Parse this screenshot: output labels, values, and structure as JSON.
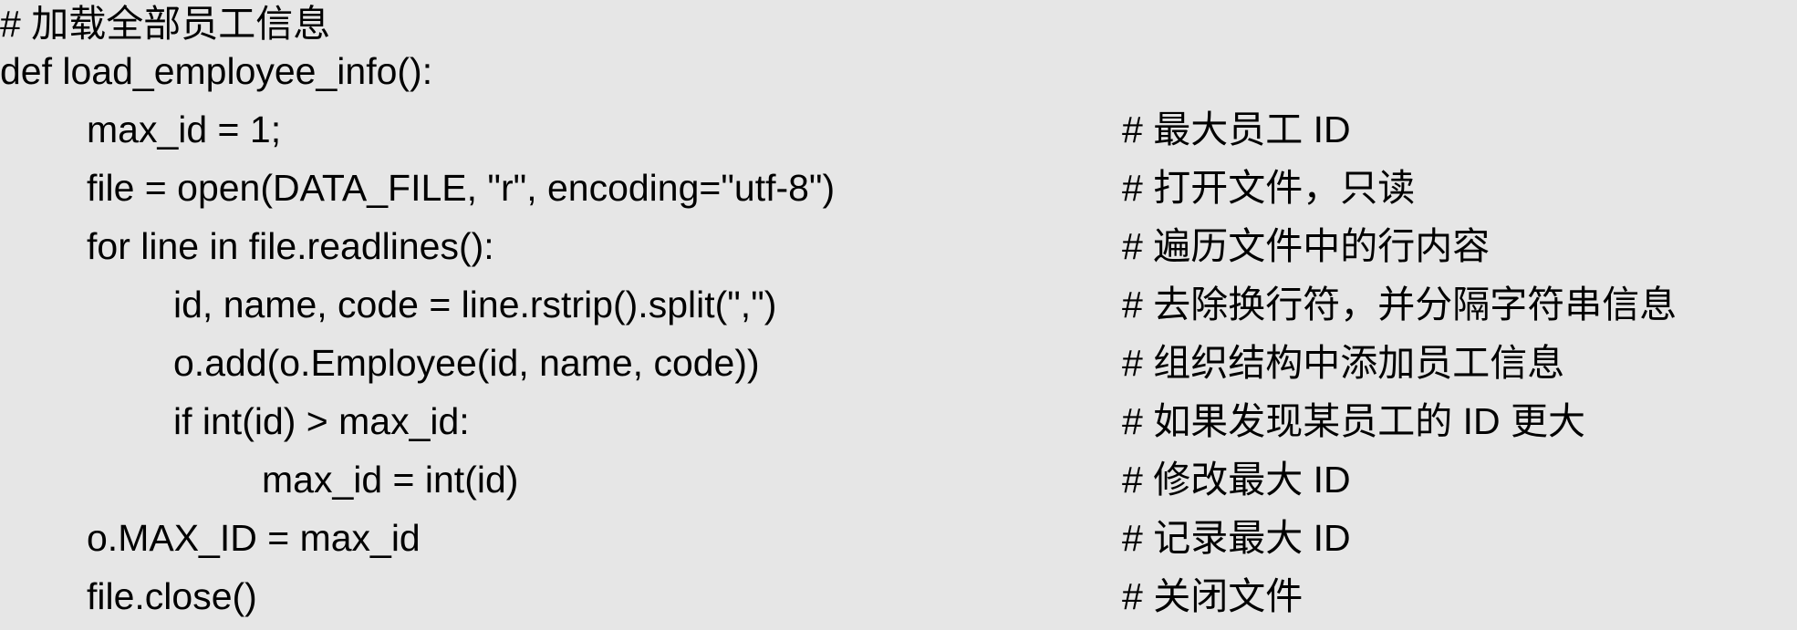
{
  "lines": [
    {
      "code": "",
      "comment": "# 加载全部员工信息"
    },
    {
      "code": "def load_employee_info():",
      "comment": ""
    },
    {
      "code": "max_id = 1;",
      "comment": "# 最大员工 ID"
    },
    {
      "code": "file = open(DATA_FILE, \"r\", encoding=\"utf-8\")",
      "comment": "# 打开文件，只读"
    },
    {
      "code": "for line in file.readlines():",
      "comment": "# 遍历文件中的行内容"
    },
    {
      "code": "id, name, code = line.rstrip().split(\",\")",
      "comment": "# 去除换行符，并分隔字符串信息"
    },
    {
      "code": "o.add(o.Employee(id, name, code))",
      "comment": "# 组织结构中添加员工信息"
    },
    {
      "code": "if int(id) > max_id:",
      "comment": "# 如果发现某员工的 ID 更大"
    },
    {
      "code": "max_id = int(id)",
      "comment": "# 修改最大 ID"
    },
    {
      "code": "o.MAX_ID = max_id",
      "comment": "# 记录最大 ID"
    },
    {
      "code": "file.close()",
      "comment": "# 关闭文件"
    }
  ]
}
